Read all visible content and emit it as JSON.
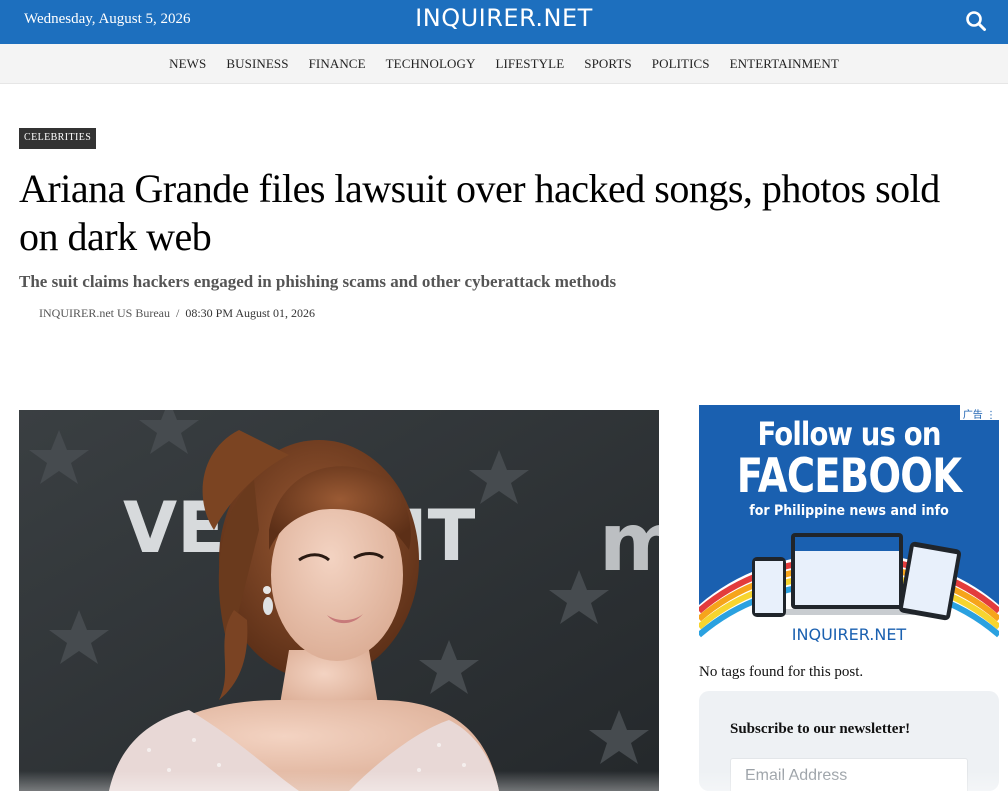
{
  "header": {
    "date": "Wednesday, August 5, 2026",
    "logo": "INQUIRER.NET",
    "search_icon": "search-icon"
  },
  "nav": {
    "items": [
      "NEWS",
      "BUSINESS",
      "FINANCE",
      "TECHNOLOGY",
      "LIFESTYLE",
      "SPORTS",
      "POLITICS",
      "ENTERTAINMENT"
    ]
  },
  "article": {
    "category": "CELEBRITIES",
    "headline": "Ariana Grande files lawsuit over hacked songs, photos sold on dark web",
    "subhead": "The suit claims hackers engaged in phishing scams and other cyberattack methods",
    "author": "INQUIRER.net US Bureau",
    "separator": "/",
    "timestamp": "08:30 PM August 01, 2026"
  },
  "sidebar": {
    "ad": {
      "line1": "Follow us on",
      "line2": "FACEBOOK",
      "line3": "for Philippine news and info",
      "brand": "INQUIRER.NET",
      "ad_label": "广告"
    },
    "no_tags": "No tags found for this post.",
    "newsletter": {
      "title": "Subscribe to our newsletter!",
      "placeholder": "Email Address"
    }
  },
  "colors": {
    "brand_blue": "#1d6fbe",
    "nav_bg": "#f4f4f4",
    "tag_bg": "#333333"
  }
}
